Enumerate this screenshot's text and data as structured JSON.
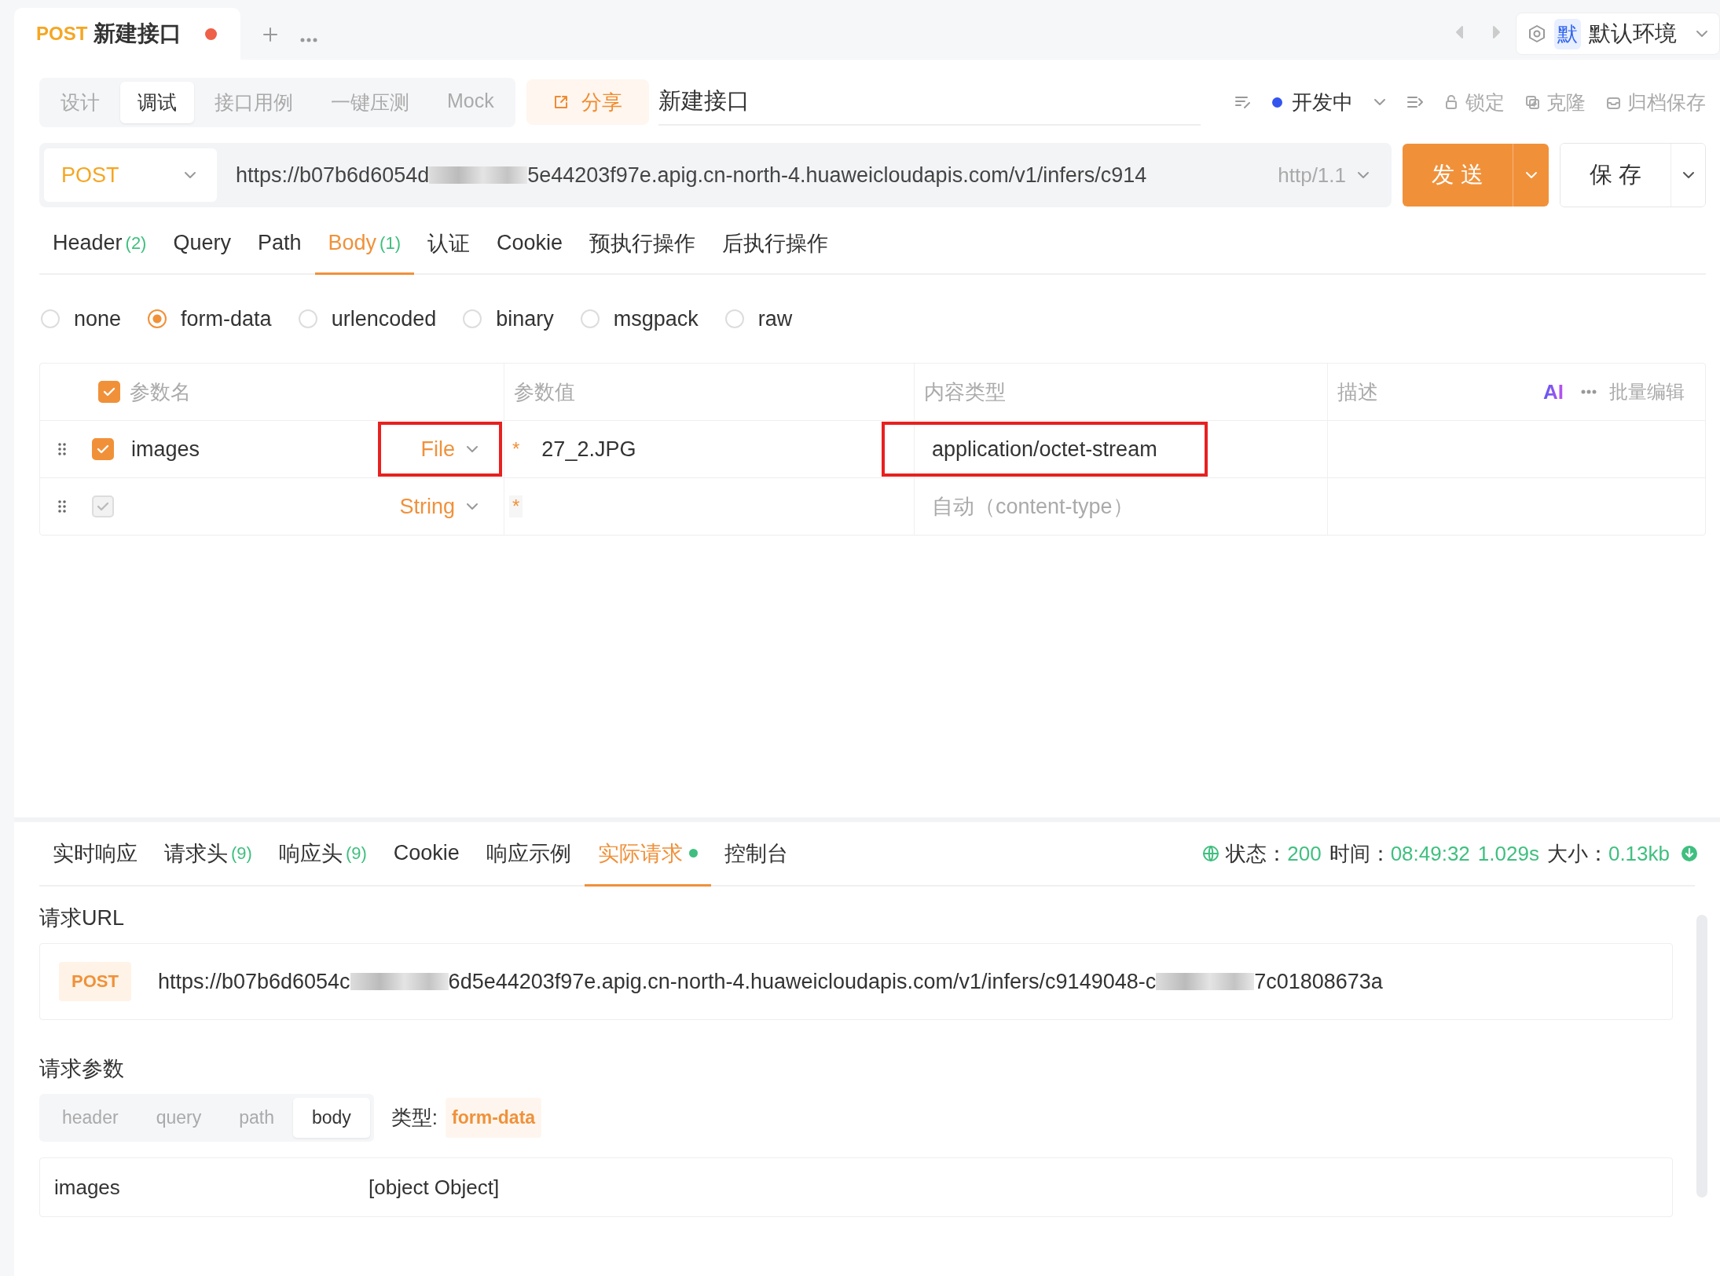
{
  "tabs": [
    {
      "method": "POST",
      "title": "新建接口",
      "unsaved": true
    }
  ],
  "environment": {
    "badge": "默",
    "name": "默认环境"
  },
  "mode_tabs": [
    {
      "label": "设计",
      "selected": false
    },
    {
      "label": "调试",
      "selected": true
    },
    {
      "label": "接口用例",
      "selected": false
    },
    {
      "label": "一键压测",
      "selected": false
    },
    {
      "label": "Mock",
      "selected": false
    }
  ],
  "share_button": "分享",
  "api_name": "新建接口",
  "status": {
    "label": "开发中",
    "color": "#3355ee"
  },
  "actions": [
    {
      "kind": "lock",
      "label": "锁定"
    },
    {
      "kind": "clone",
      "label": "克隆"
    },
    {
      "kind": "archive",
      "label": "归档保存"
    }
  ],
  "request": {
    "method": "POST",
    "url_parts": [
      {
        "kind": "text",
        "text": "https://b07b6d6054d"
      },
      {
        "kind": "redacted"
      },
      {
        "kind": "text",
        "text": "5e44203f97e.apig.cn-north-4.huaweicloudapis.com/v1/infers/c914"
      }
    ],
    "protocol": "http/1.1",
    "send": "发 送",
    "save": "保 存"
  },
  "param_tabs": [
    {
      "label": "Header",
      "count": "(2)",
      "selected": false
    },
    {
      "label": "Query",
      "selected": false
    },
    {
      "label": "Path",
      "selected": false
    },
    {
      "label": "Body",
      "count": "(1)",
      "selected": true
    },
    {
      "label": "认证",
      "selected": false
    },
    {
      "label": "Cookie",
      "selected": false
    },
    {
      "label": "预执行操作",
      "selected": false
    },
    {
      "label": "后执行操作",
      "selected": false
    }
  ],
  "body_types": [
    {
      "label": "none",
      "selected": false
    },
    {
      "label": "form-data",
      "selected": true
    },
    {
      "label": "urlencoded",
      "selected": false
    },
    {
      "label": "binary",
      "selected": false
    },
    {
      "label": "msgpack",
      "selected": false
    },
    {
      "label": "raw",
      "selected": false
    }
  ],
  "params_table": {
    "columns": [
      "参数名",
      "参数值",
      "内容类型",
      "描述"
    ],
    "all_checked": true,
    "ai_label": "AI",
    "batch_edit": "批量编辑",
    "rows": [
      {
        "checked": true,
        "disabled": false,
        "name": "images",
        "type": "File",
        "type_highlighted": true,
        "required_mark": "*",
        "value": "27_2.JPG",
        "content_type": "application/octet-stream",
        "content_type_highlighted": true
      },
      {
        "checked": true,
        "disabled": true,
        "type": "String",
        "type_highlighted": false,
        "required_mark": "*",
        "content_type_placeholder": "自动（content-type）",
        "content_type_highlighted": false
      }
    ]
  },
  "response_tabs": [
    {
      "label": "实时响应",
      "selected": false,
      "dot": false
    },
    {
      "label": "请求头",
      "count": "(9)",
      "selected": false,
      "dot": false
    },
    {
      "label": "响应头",
      "count": "(9)",
      "selected": false,
      "dot": false
    },
    {
      "label": "Cookie",
      "selected": false,
      "dot": false
    },
    {
      "label": "响应示例",
      "selected": false,
      "dot": false
    },
    {
      "label": "实际请求",
      "selected": true,
      "dot": true
    },
    {
      "label": "控制台",
      "selected": false,
      "dot": false
    }
  ],
  "response_meta": {
    "status_label": "状态：",
    "status": "200",
    "time_label": "时间：",
    "time": "08:49:32",
    "duration": "1.029s",
    "size_label": "大小：",
    "size": "0.13kb"
  },
  "actual_request": {
    "url_label": "请求URL",
    "method": "POST",
    "url_parts": [
      {
        "kind": "text",
        "text": "https://b07b6d6054c"
      },
      {
        "kind": "redacted"
      },
      {
        "kind": "text",
        "text": "6d5e44203f97e.apig.cn-north-4.huaweicloudapis.com/v1/infers/c9149048-c"
      },
      {
        "kind": "redacted"
      },
      {
        "kind": "text",
        "text": "7c01808673a"
      }
    ],
    "params_label": "请求参数",
    "sub_tabs": [
      {
        "label": "header",
        "selected": false
      },
      {
        "label": "query",
        "selected": false
      },
      {
        "label": "path",
        "selected": false
      },
      {
        "label": "body",
        "selected": true
      }
    ],
    "type_label": "类型:",
    "type": "form-data",
    "rows": [
      {
        "name": "images",
        "value": "[object Object]"
      }
    ]
  }
}
